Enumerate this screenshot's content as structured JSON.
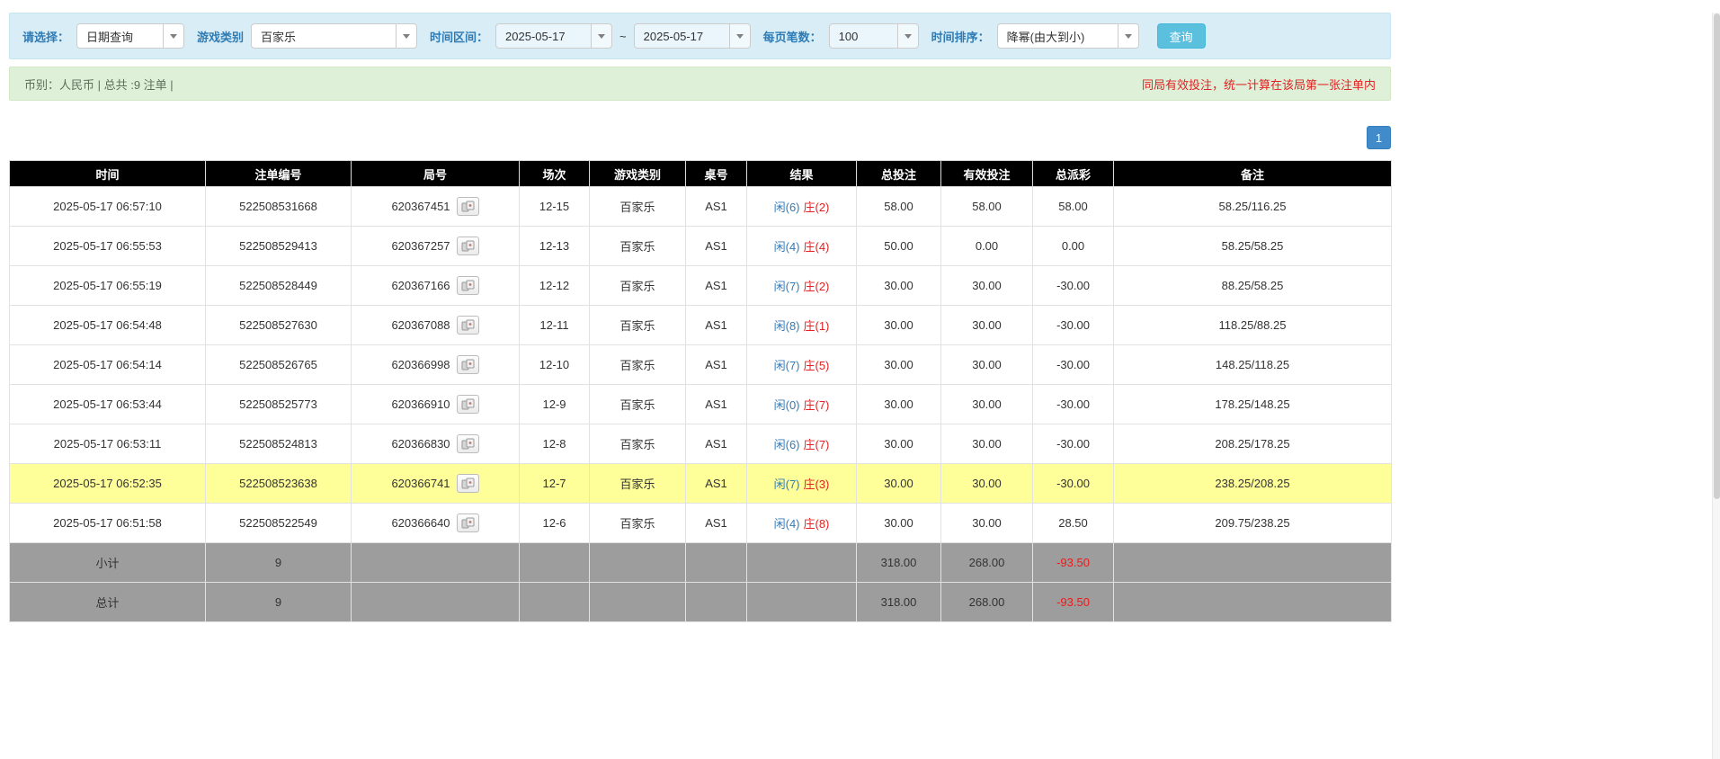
{
  "filters": {
    "select_label": "请选择：",
    "select_value": "日期查询",
    "game_label": "游戏类别",
    "game_value": "百家乐",
    "range_label": "时间区间：",
    "date_from": "2025-05-17",
    "tilde": "~",
    "date_to": "2025-05-17",
    "page_size_label": "每页笔数：",
    "page_size_value": "100",
    "sort_label": "时间排序：",
    "sort_value": "降幂(由大到小)",
    "search_button": "查询"
  },
  "summary_bar": {
    "left": "币别：人民币 | 总共 :9 注单 |",
    "right": "同局有效投注，统一计算在该局第一张注单内"
  },
  "pagination": {
    "pages": [
      "1"
    ],
    "active": "1"
  },
  "colors": {
    "accent_blue": "#337ab7",
    "result_red": "#e02222",
    "highlight_yellow": "#ffff99",
    "header_black": "#000000",
    "footer_gray": "#9d9d9d",
    "filter_bar_blue": "#d9edf7",
    "summary_green": "#dff0d8",
    "search_button_cyan": "#5bc0de"
  },
  "icons": {
    "view_cards": "view-cards-icon",
    "caret": "chevron-down-icon"
  },
  "table": {
    "headers": [
      "时间",
      "注单编号",
      "局号",
      "场次",
      "游戏类别",
      "桌号",
      "结果",
      "总投注",
      "有效投注",
      "总派彩",
      "备注"
    ],
    "rows": [
      {
        "time": "2025-05-17 06:57:10",
        "bet_id": "522508531668",
        "round": "620367451",
        "session": "12-15",
        "game": "百家乐",
        "table": "AS1",
        "result_player": "闲(6)",
        "result_banker": "庄(2)",
        "total_bet": "58.00",
        "valid_bet": "58.00",
        "payout": "58.00",
        "remark": "58.25/116.25",
        "highlight": false
      },
      {
        "time": "2025-05-17 06:55:53",
        "bet_id": "522508529413",
        "round": "620367257",
        "session": "12-13",
        "game": "百家乐",
        "table": "AS1",
        "result_player": "闲(4)",
        "result_banker": "庄(4)",
        "total_bet": "50.00",
        "valid_bet": "0.00",
        "payout": "0.00",
        "remark": "58.25/58.25",
        "highlight": false
      },
      {
        "time": "2025-05-17 06:55:19",
        "bet_id": "522508528449",
        "round": "620367166",
        "session": "12-12",
        "game": "百家乐",
        "table": "AS1",
        "result_player": "闲(7)",
        "result_banker": "庄(2)",
        "total_bet": "30.00",
        "valid_bet": "30.00",
        "payout": "-30.00",
        "remark": "88.25/58.25",
        "highlight": false
      },
      {
        "time": "2025-05-17 06:54:48",
        "bet_id": "522508527630",
        "round": "620367088",
        "session": "12-11",
        "game": "百家乐",
        "table": "AS1",
        "result_player": "闲(8)",
        "result_banker": "庄(1)",
        "total_bet": "30.00",
        "valid_bet": "30.00",
        "payout": "-30.00",
        "remark": "118.25/88.25",
        "highlight": false
      },
      {
        "time": "2025-05-17 06:54:14",
        "bet_id": "522508526765",
        "round": "620366998",
        "session": "12-10",
        "game": "百家乐",
        "table": "AS1",
        "result_player": "闲(7)",
        "result_banker": "庄(5)",
        "total_bet": "30.00",
        "valid_bet": "30.00",
        "payout": "-30.00",
        "remark": "148.25/118.25",
        "highlight": false
      },
      {
        "time": "2025-05-17 06:53:44",
        "bet_id": "522508525773",
        "round": "620366910",
        "session": "12-9",
        "game": "百家乐",
        "table": "AS1",
        "result_player": "闲(0)",
        "result_banker": "庄(7)",
        "total_bet": "30.00",
        "valid_bet": "30.00",
        "payout": "-30.00",
        "remark": "178.25/148.25",
        "highlight": false
      },
      {
        "time": "2025-05-17 06:53:11",
        "bet_id": "522508524813",
        "round": "620366830",
        "session": "12-8",
        "game": "百家乐",
        "table": "AS1",
        "result_player": "闲(6)",
        "result_banker": "庄(7)",
        "total_bet": "30.00",
        "valid_bet": "30.00",
        "payout": "-30.00",
        "remark": "208.25/178.25",
        "highlight": false
      },
      {
        "time": "2025-05-17 06:52:35",
        "bet_id": "522508523638",
        "round": "620366741",
        "session": "12-7",
        "game": "百家乐",
        "table": "AS1",
        "result_player": "闲(7)",
        "result_banker": "庄(3)",
        "total_bet": "30.00",
        "valid_bet": "30.00",
        "payout": "-30.00",
        "remark": "238.25/208.25",
        "highlight": true
      },
      {
        "time": "2025-05-17 06:51:58",
        "bet_id": "522508522549",
        "round": "620366640",
        "session": "12-6",
        "game": "百家乐",
        "table": "AS1",
        "result_player": "闲(4)",
        "result_banker": "庄(8)",
        "total_bet": "30.00",
        "valid_bet": "30.00",
        "payout": "28.50",
        "remark": "209.75/238.25",
        "highlight": false
      }
    ],
    "footer": [
      {
        "label": "小计",
        "count": "9",
        "total_bet": "318.00",
        "valid_bet": "268.00",
        "payout": "-93.50"
      },
      {
        "label": "总计",
        "count": "9",
        "total_bet": "318.00",
        "valid_bet": "268.00",
        "payout": "-93.50"
      }
    ]
  }
}
